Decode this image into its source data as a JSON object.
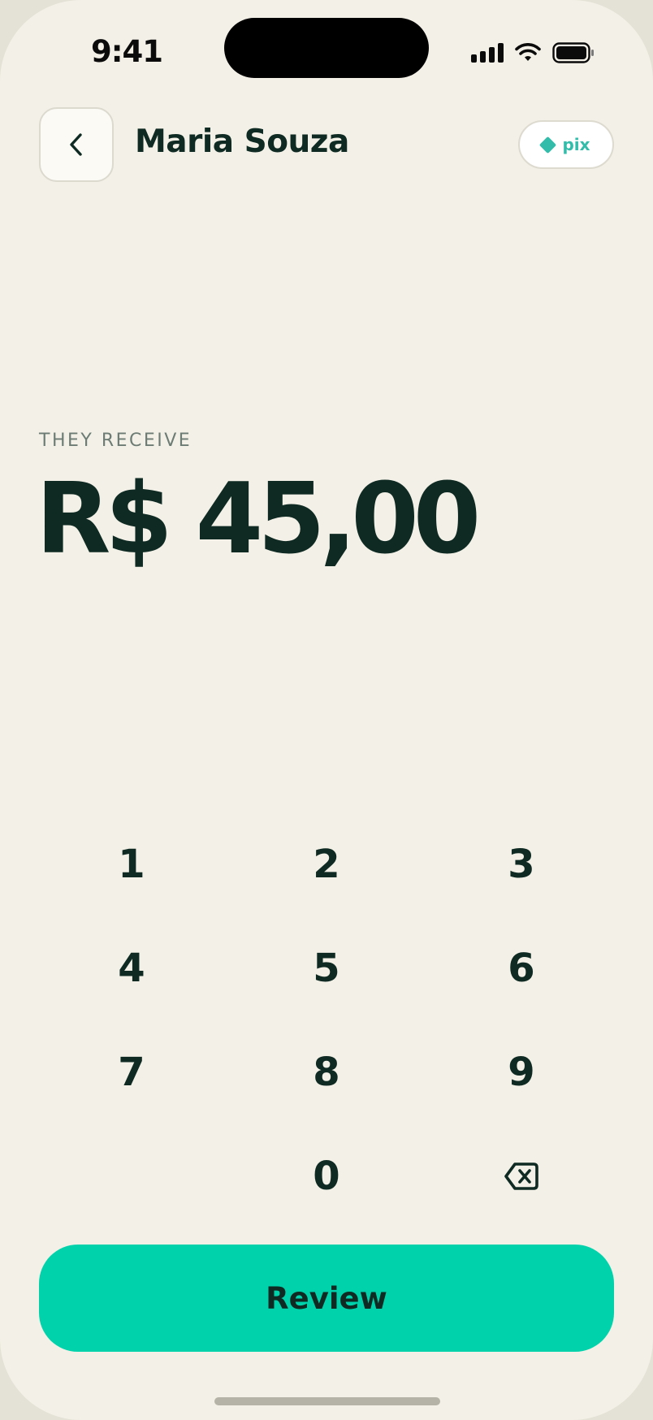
{
  "status_bar": {
    "time": "9:41",
    "icons": [
      "cellular-signal-icon",
      "wifi-icon",
      "battery-icon"
    ]
  },
  "header": {
    "back_icon": "chevron-left-icon",
    "title": "Maria Souza",
    "payment_method": "pix",
    "payment_method_icon": "pix-diamond-icon"
  },
  "amount": {
    "label": "THEY RECEIVE",
    "value": "R$ 45,00"
  },
  "keypad": {
    "keys": [
      "1",
      "2",
      "3",
      "4",
      "5",
      "6",
      "7",
      "8",
      "9",
      "",
      "0"
    ],
    "backspace_icon": "backspace-icon"
  },
  "review": {
    "label": "Review"
  },
  "colors": {
    "background": "#f3f0e7",
    "text": "#0e2a22",
    "accent": "#00d3ac",
    "pix": "#32bca9",
    "muted": "#6c7c74"
  }
}
